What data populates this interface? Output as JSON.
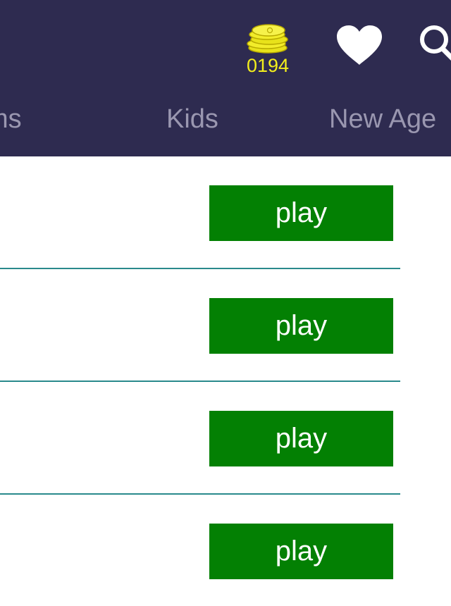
{
  "header": {
    "coins": {
      "icon": "coin-stack-icon",
      "count": "0194",
      "color": "#f3ee1c"
    },
    "favorites_icon": "heart-icon",
    "search_icon": "search-icon",
    "background": "#2e2b50"
  },
  "tabs": [
    {
      "label": "ms"
    },
    {
      "label": "Kids"
    },
    {
      "label": "New Age"
    }
  ],
  "list": {
    "items": [
      {
        "play_label": "play"
      },
      {
        "play_label": "play"
      },
      {
        "play_label": "play"
      },
      {
        "play_label": "play"
      }
    ],
    "button_color": "#038003",
    "divider_color": "#2a8a8c"
  }
}
